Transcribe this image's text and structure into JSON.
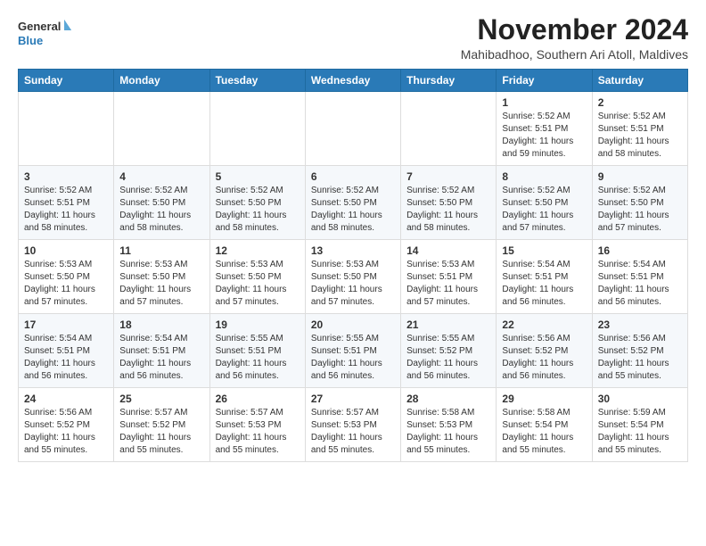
{
  "header": {
    "logo_line1": "General",
    "logo_line2": "Blue",
    "month_title": "November 2024",
    "location": "Mahibadhoo, Southern Ari Atoll, Maldives"
  },
  "weekdays": [
    "Sunday",
    "Monday",
    "Tuesday",
    "Wednesday",
    "Thursday",
    "Friday",
    "Saturday"
  ],
  "weeks": [
    [
      {
        "day": "",
        "info": ""
      },
      {
        "day": "",
        "info": ""
      },
      {
        "day": "",
        "info": ""
      },
      {
        "day": "",
        "info": ""
      },
      {
        "day": "",
        "info": ""
      },
      {
        "day": "1",
        "info": "Sunrise: 5:52 AM\nSunset: 5:51 PM\nDaylight: 11 hours and 59 minutes."
      },
      {
        "day": "2",
        "info": "Sunrise: 5:52 AM\nSunset: 5:51 PM\nDaylight: 11 hours and 58 minutes."
      }
    ],
    [
      {
        "day": "3",
        "info": "Sunrise: 5:52 AM\nSunset: 5:51 PM\nDaylight: 11 hours and 58 minutes."
      },
      {
        "day": "4",
        "info": "Sunrise: 5:52 AM\nSunset: 5:50 PM\nDaylight: 11 hours and 58 minutes."
      },
      {
        "day": "5",
        "info": "Sunrise: 5:52 AM\nSunset: 5:50 PM\nDaylight: 11 hours and 58 minutes."
      },
      {
        "day": "6",
        "info": "Sunrise: 5:52 AM\nSunset: 5:50 PM\nDaylight: 11 hours and 58 minutes."
      },
      {
        "day": "7",
        "info": "Sunrise: 5:52 AM\nSunset: 5:50 PM\nDaylight: 11 hours and 58 minutes."
      },
      {
        "day": "8",
        "info": "Sunrise: 5:52 AM\nSunset: 5:50 PM\nDaylight: 11 hours and 57 minutes."
      },
      {
        "day": "9",
        "info": "Sunrise: 5:52 AM\nSunset: 5:50 PM\nDaylight: 11 hours and 57 minutes."
      }
    ],
    [
      {
        "day": "10",
        "info": "Sunrise: 5:53 AM\nSunset: 5:50 PM\nDaylight: 11 hours and 57 minutes."
      },
      {
        "day": "11",
        "info": "Sunrise: 5:53 AM\nSunset: 5:50 PM\nDaylight: 11 hours and 57 minutes."
      },
      {
        "day": "12",
        "info": "Sunrise: 5:53 AM\nSunset: 5:50 PM\nDaylight: 11 hours and 57 minutes."
      },
      {
        "day": "13",
        "info": "Sunrise: 5:53 AM\nSunset: 5:50 PM\nDaylight: 11 hours and 57 minutes."
      },
      {
        "day": "14",
        "info": "Sunrise: 5:53 AM\nSunset: 5:51 PM\nDaylight: 11 hours and 57 minutes."
      },
      {
        "day": "15",
        "info": "Sunrise: 5:54 AM\nSunset: 5:51 PM\nDaylight: 11 hours and 56 minutes."
      },
      {
        "day": "16",
        "info": "Sunrise: 5:54 AM\nSunset: 5:51 PM\nDaylight: 11 hours and 56 minutes."
      }
    ],
    [
      {
        "day": "17",
        "info": "Sunrise: 5:54 AM\nSunset: 5:51 PM\nDaylight: 11 hours and 56 minutes."
      },
      {
        "day": "18",
        "info": "Sunrise: 5:54 AM\nSunset: 5:51 PM\nDaylight: 11 hours and 56 minutes."
      },
      {
        "day": "19",
        "info": "Sunrise: 5:55 AM\nSunset: 5:51 PM\nDaylight: 11 hours and 56 minutes."
      },
      {
        "day": "20",
        "info": "Sunrise: 5:55 AM\nSunset: 5:51 PM\nDaylight: 11 hours and 56 minutes."
      },
      {
        "day": "21",
        "info": "Sunrise: 5:55 AM\nSunset: 5:52 PM\nDaylight: 11 hours and 56 minutes."
      },
      {
        "day": "22",
        "info": "Sunrise: 5:56 AM\nSunset: 5:52 PM\nDaylight: 11 hours and 56 minutes."
      },
      {
        "day": "23",
        "info": "Sunrise: 5:56 AM\nSunset: 5:52 PM\nDaylight: 11 hours and 55 minutes."
      }
    ],
    [
      {
        "day": "24",
        "info": "Sunrise: 5:56 AM\nSunset: 5:52 PM\nDaylight: 11 hours and 55 minutes."
      },
      {
        "day": "25",
        "info": "Sunrise: 5:57 AM\nSunset: 5:52 PM\nDaylight: 11 hours and 55 minutes."
      },
      {
        "day": "26",
        "info": "Sunrise: 5:57 AM\nSunset: 5:53 PM\nDaylight: 11 hours and 55 minutes."
      },
      {
        "day": "27",
        "info": "Sunrise: 5:57 AM\nSunset: 5:53 PM\nDaylight: 11 hours and 55 minutes."
      },
      {
        "day": "28",
        "info": "Sunrise: 5:58 AM\nSunset: 5:53 PM\nDaylight: 11 hours and 55 minutes."
      },
      {
        "day": "29",
        "info": "Sunrise: 5:58 AM\nSunset: 5:54 PM\nDaylight: 11 hours and 55 minutes."
      },
      {
        "day": "30",
        "info": "Sunrise: 5:59 AM\nSunset: 5:54 PM\nDaylight: 11 hours and 55 minutes."
      }
    ]
  ]
}
